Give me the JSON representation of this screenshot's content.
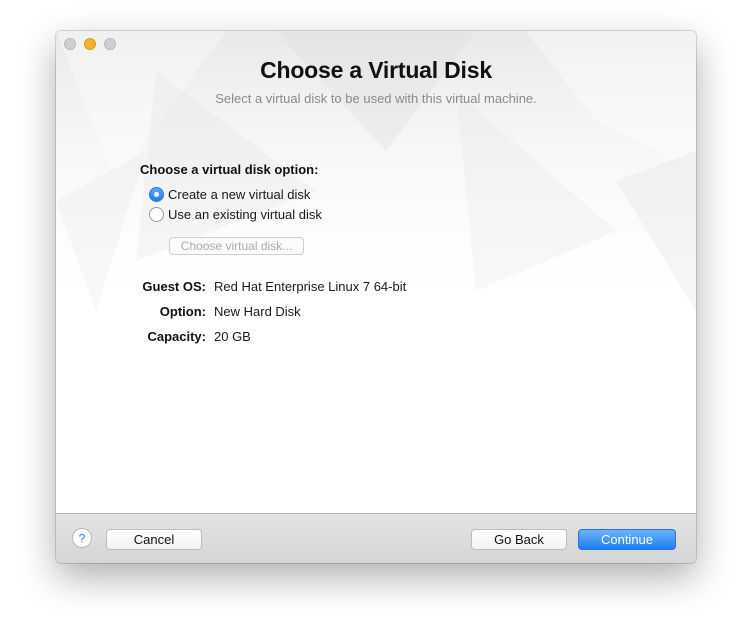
{
  "window": {
    "title": "Choose a Virtual Disk",
    "subtitle": "Select a virtual disk to be used with this virtual machine."
  },
  "disk_option": {
    "label": "Choose a virtual disk option:",
    "options": [
      {
        "label": "Create a new virtual disk",
        "selected": true
      },
      {
        "label": "Use an existing virtual disk",
        "selected": false
      }
    ],
    "choose_button": "Choose virtual disk..."
  },
  "summary": [
    {
      "label": "Guest OS:",
      "value": "Red Hat Enterprise Linux 7 64-bit"
    },
    {
      "label": "Option:",
      "value": "New Hard Disk"
    },
    {
      "label": "Capacity:",
      "value": "20 GB"
    }
  ],
  "footer": {
    "help_label": "?",
    "cancel": "Cancel",
    "go_back": "Go Back",
    "continue": "Continue"
  },
  "colors": {
    "accent": "#1d78f2",
    "minimize": "#f6b12a"
  }
}
